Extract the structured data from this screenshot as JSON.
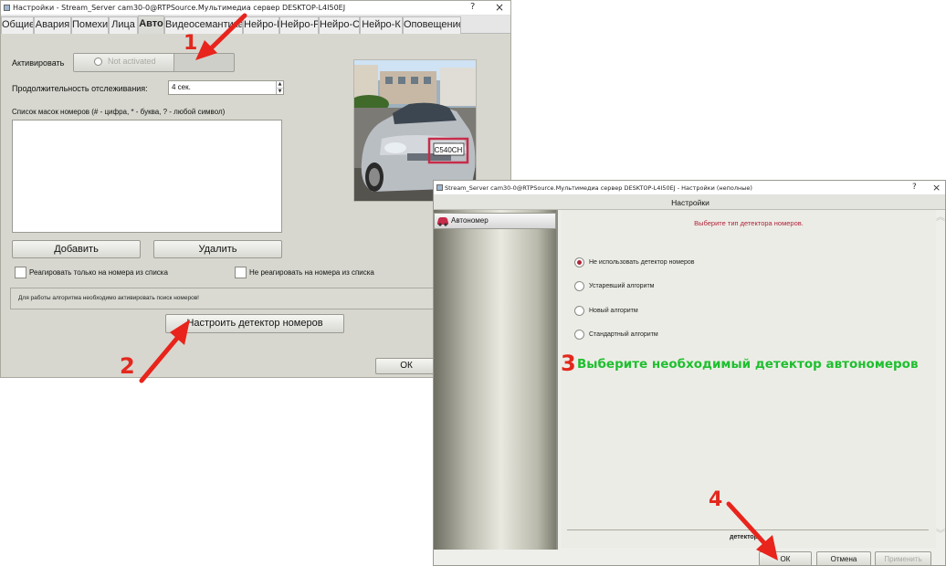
{
  "window1": {
    "title": "Настройки - Stream_Server cam30-0@RTPSource.Мультимедиа сервер DESKTOP-L4I50EJ",
    "help_glyph": "?",
    "close_glyph": "×",
    "tabs": [
      "Общие",
      "Авария",
      "Помехи",
      "Лица",
      "Авто",
      "Видеосемантика",
      "Нейро-Б",
      "Нейро-Р",
      "Нейро-С",
      "Нейро-К",
      "Оповещение"
    ],
    "active_tab": "Авто",
    "activate_label": "Активировать",
    "activate_value": "Not activated",
    "tracking_label": "Продолжительность отслеживания:",
    "tracking_value": "4 сек.",
    "mask_list_label": "Список масок номеров (# - цифра, * - буква, ? - любой символ)",
    "add_button": "Добавить",
    "delete_button": "Удалить",
    "check_only_list": "Реагировать только на номера из списка",
    "check_not_list": "Не реагировать на номера из списка",
    "info_text": "Для работы алгоритма необходимо активировать поиск номеров!",
    "configure_button": "Настроить детектор номеров",
    "ok_button": "ОК",
    "plate_text": "C540CH"
  },
  "window2": {
    "title": "Stream_Server cam30-0@RTPSource.Мультимедиа сервер DESKTOP-L4I50EJ - Настройки (неполные)",
    "help_glyph": "?",
    "close_glyph": "×",
    "header": "Настройки",
    "sidebar_item": "Автономер",
    "prompt": "Выберите тип детектора номеров.",
    "options": [
      {
        "label": "Не использовать детектор номеров",
        "selected": true
      },
      {
        "label": "Устаревший алгоритм",
        "selected": false
      },
      {
        "label": "Новый алгоритм",
        "selected": false
      },
      {
        "label": "Стандартный алгоритм",
        "selected": false
      }
    ],
    "bottom_label": "детектор",
    "ok_button": "ОК",
    "cancel_button": "Отмена",
    "apply_button": "Применить"
  },
  "annotations": {
    "step1": "1",
    "step2": "2",
    "step3": "3",
    "step3_text": "Выберите необходимый детектор автономеров",
    "step4": "4",
    "arrow_color": "#e8241c",
    "step3_text_color": "#1fbf2f"
  },
  "colors": {
    "accent_red": "#b0243a",
    "window_bg": "#d7d7cf"
  }
}
